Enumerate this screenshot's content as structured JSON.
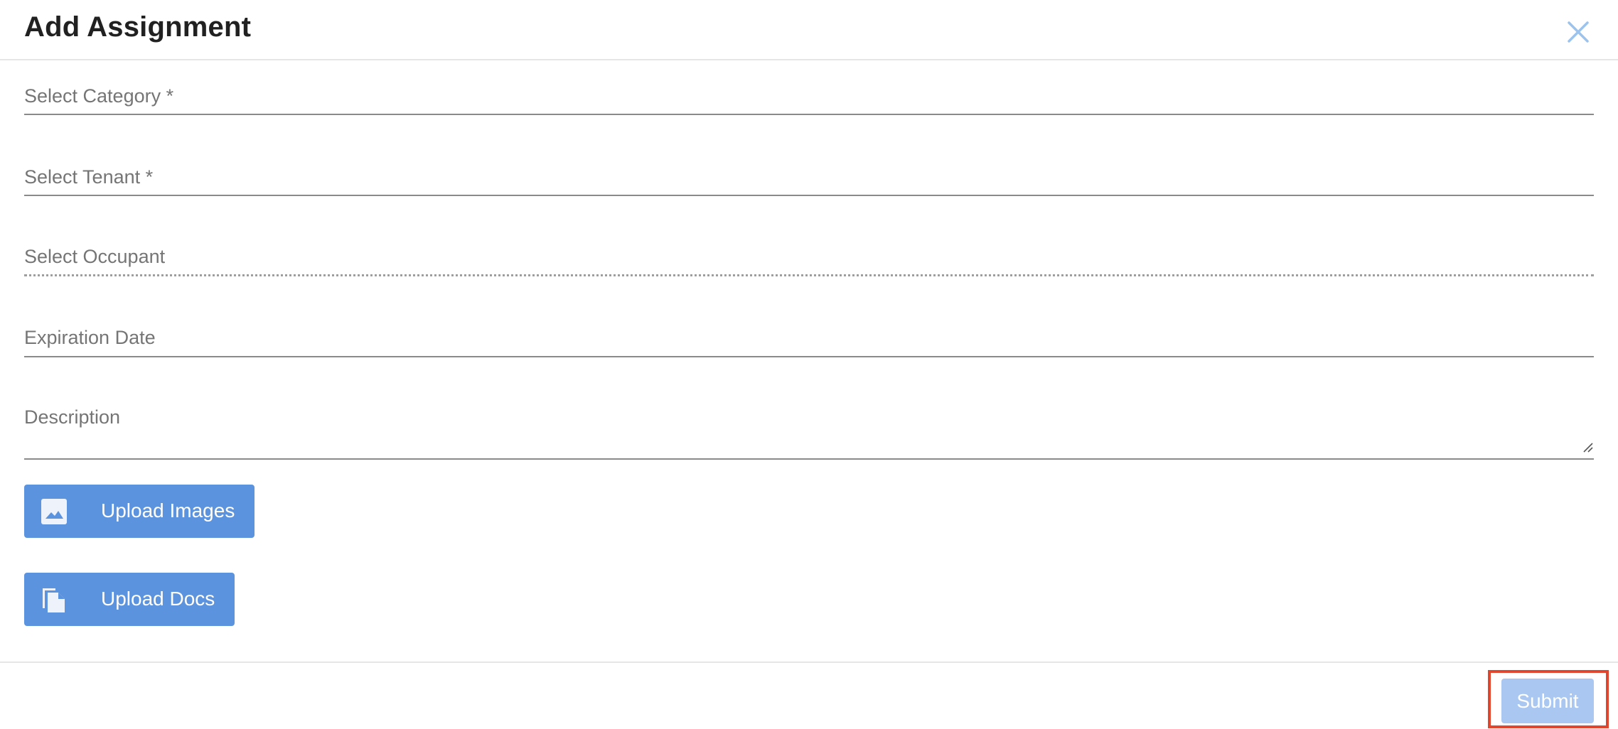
{
  "dialog": {
    "title": "Add Assignment"
  },
  "form": {
    "category_label": "Select Category *",
    "tenant_label": "Select Tenant *",
    "occupant_label": "Select Occupant",
    "expiration_label": "Expiration Date",
    "description_label": "Description"
  },
  "uploads": {
    "images_label": "Upload Images",
    "docs_label": "Upload Docs"
  },
  "footer": {
    "submit_label": "Submit"
  },
  "colors": {
    "primary_button": "#5c93de",
    "disabled_button": "#a9c7f0",
    "highlight_border": "#e0452e",
    "close_icon": "#9cc3ee"
  },
  "icons": {
    "close": "close-icon",
    "image": "image-icon",
    "docs": "docs-icon"
  }
}
